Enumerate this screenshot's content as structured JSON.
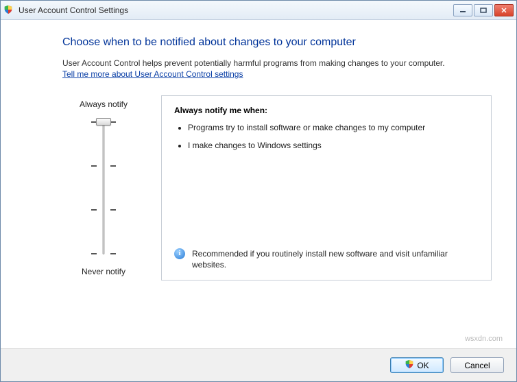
{
  "window": {
    "title": "User Account Control Settings"
  },
  "heading": "Choose when to be notified about changes to your computer",
  "intro": "User Account Control helps prevent potentially harmful programs from making changes to your computer.",
  "link": "Tell me more about User Account Control settings",
  "slider": {
    "top_label": "Always notify",
    "bottom_label": "Never notify",
    "levels": 4,
    "selected_level": 3
  },
  "panel": {
    "title": "Always notify me when:",
    "bullets": [
      "Programs try to install software or make changes to my computer",
      "I make changes to Windows settings"
    ],
    "recommendation": "Recommended if you routinely install new software and visit unfamiliar websites."
  },
  "buttons": {
    "ok": "OK",
    "cancel": "Cancel"
  },
  "watermark": "wsxdn.com"
}
